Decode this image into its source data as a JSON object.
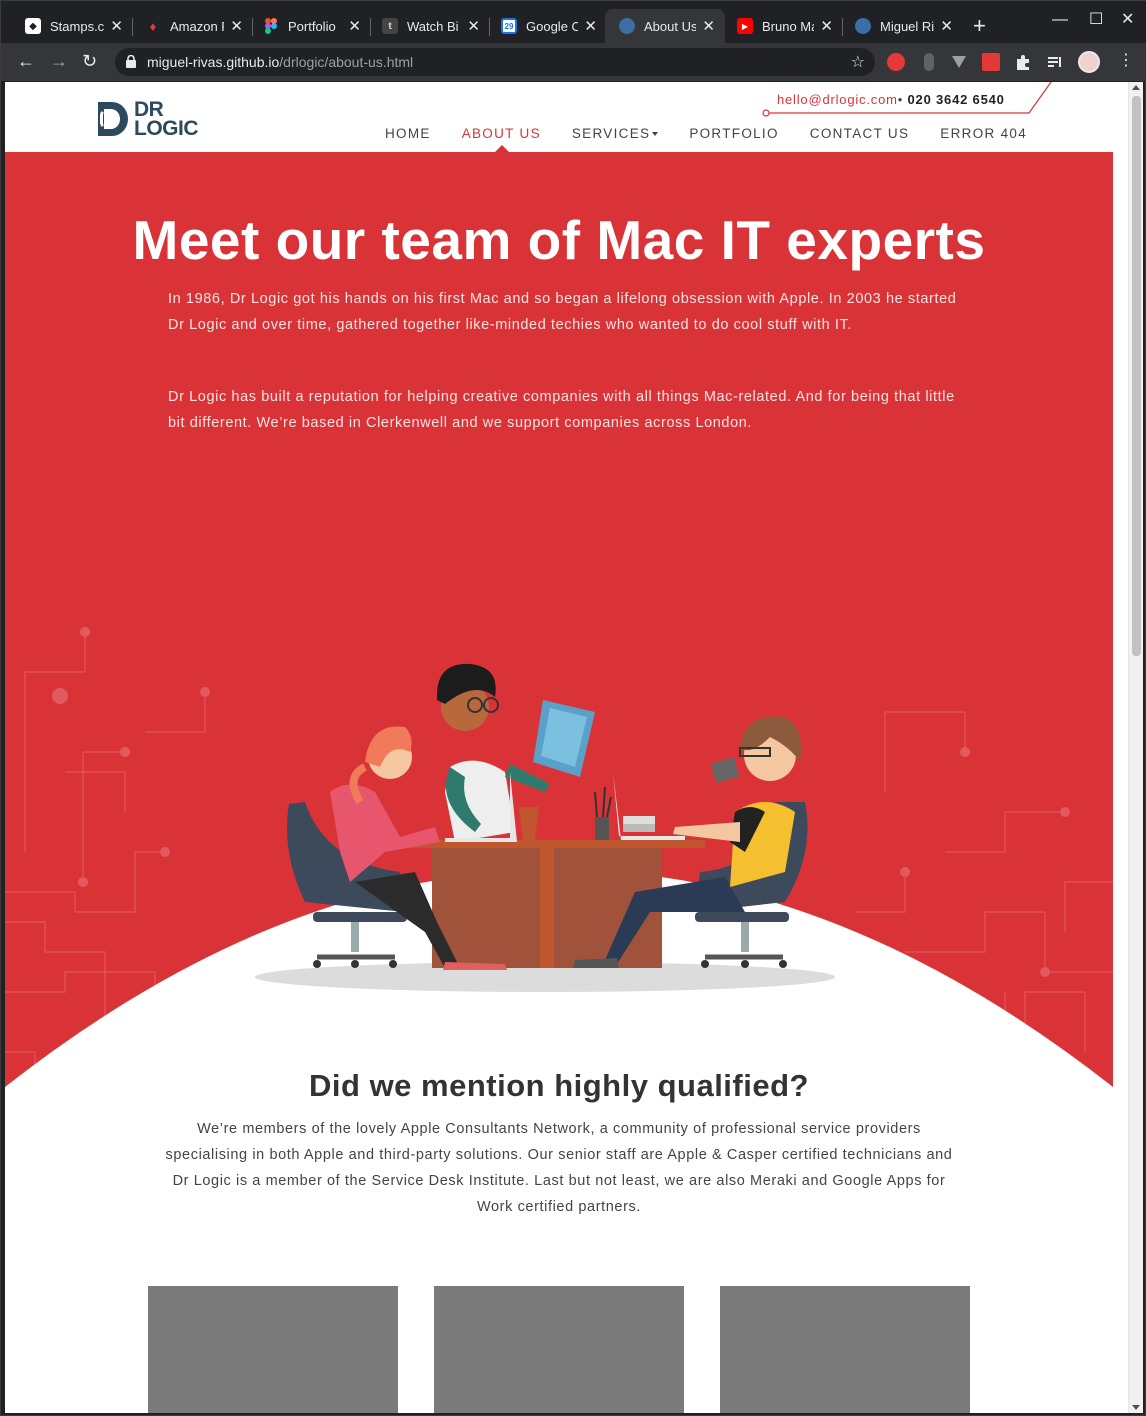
{
  "browser": {
    "tabs": [
      {
        "title": "Stamps.c",
        "favicon": "stamps-icon",
        "active": false
      },
      {
        "title": "Amazon F",
        "favicon": "amazon-icon",
        "active": false
      },
      {
        "title": "Portfolio",
        "favicon": "figma-icon",
        "active": false
      },
      {
        "title": "Watch Bi",
        "favicon": "t-icon",
        "active": false
      },
      {
        "title": "Google C",
        "favicon": "calendar-icon",
        "active": false
      },
      {
        "title": "About Us",
        "favicon": "globe-icon",
        "active": true
      },
      {
        "title": "Bruno Ma",
        "favicon": "youtube-icon",
        "active": false
      },
      {
        "title": "Miguel Ri",
        "favicon": "globe-icon",
        "active": false
      }
    ],
    "url_host": "miguel-rivas.github.io",
    "url_path": "/drlogic/about-us.html"
  },
  "site": {
    "logo": {
      "line1": "DR",
      "line2": "LOGIC"
    },
    "contact": {
      "email": "hello@drlogic.com",
      "separator": "•",
      "phone": "020 3642 6540"
    },
    "nav": [
      {
        "label": "HOME",
        "active": false
      },
      {
        "label": "ABOUT US",
        "active": true
      },
      {
        "label": "SERVICES",
        "active": false,
        "has_dropdown": true
      },
      {
        "label": "PORTFOLIO",
        "active": false
      },
      {
        "label": "CONTACT US",
        "active": false
      },
      {
        "label": "ERROR 404",
        "active": false
      }
    ]
  },
  "hero": {
    "title": "Meet our team of Mac IT experts",
    "paragraph1": "In 1986, Dr Logic got his hands on his first Mac and so began a lifelong obsession with Apple. In 2003 he started Dr Logic and over time, gathered together like-minded techies who wanted to do cool stuff with IT.",
    "paragraph2": "Dr Logic has built a reputation for helping creative companies with all things Mac-related. And for being that little bit different. We’re based in Clerkenwell and we support companies across London."
  },
  "qualified": {
    "title": "Did we mention highly qualified?",
    "body": "We’re members of the lovely Apple Consultants Network, a community of professional service providers specialising in both Apple and third-party solutions. Our senior staff are Apple & Casper certified technicians and Dr Logic is a member of the Service Desk Institute. Last but not least, we are also Meraki and Google Apps for Work certified partners."
  },
  "colors": {
    "brand_red": "#d93337",
    "logo_navy": "#2c4a5e",
    "card_gray": "#7a7a7a"
  }
}
